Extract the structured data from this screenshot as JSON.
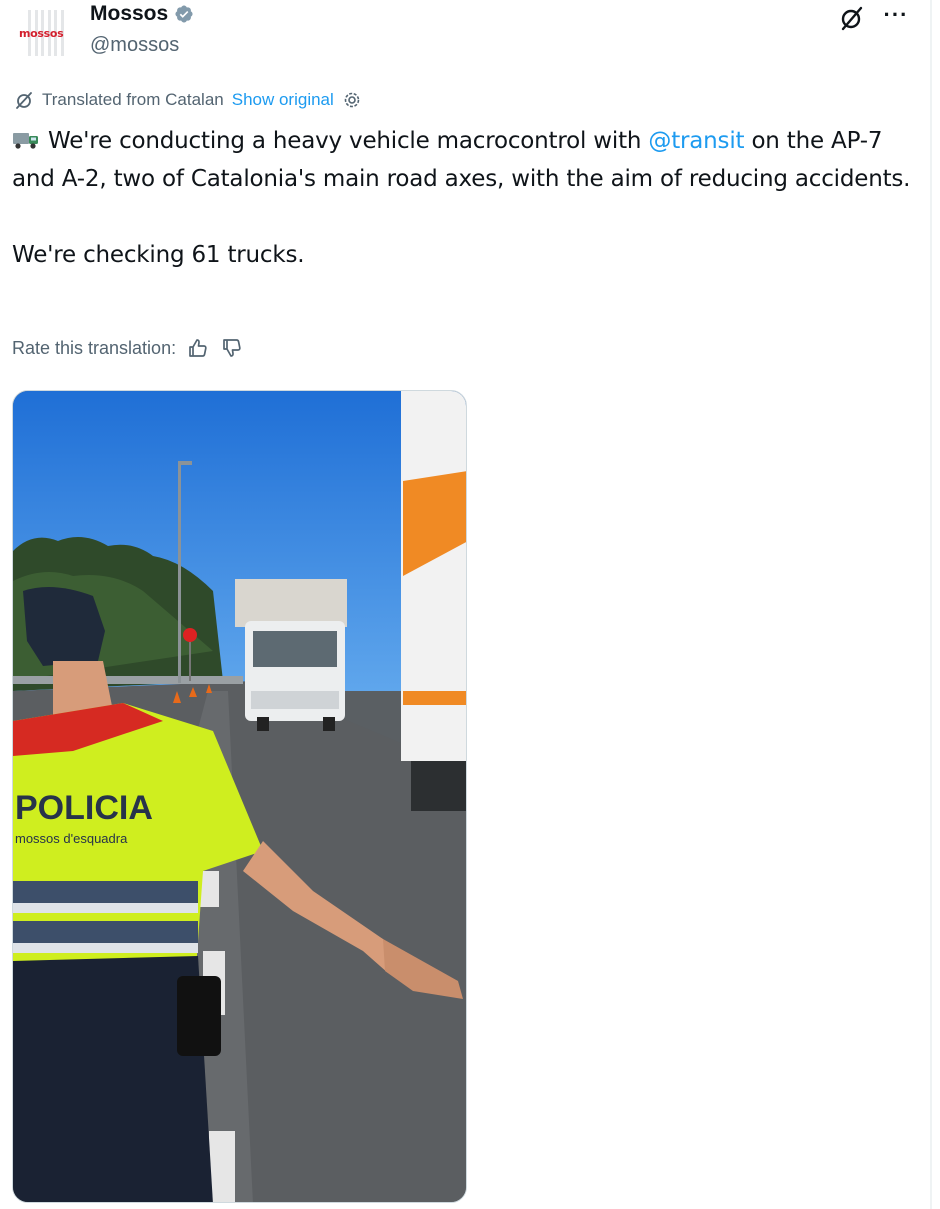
{
  "author": {
    "name": "Mossos",
    "handle": "@mossos",
    "avatar_text": "mossos",
    "verified": true,
    "verified_icon": "verified-badge-icon"
  },
  "header_actions": {
    "grok_icon": "grok-icon",
    "more_icon": "more-options-icon",
    "more_label": "···"
  },
  "translation": {
    "label": "Translated from Catalan",
    "show_original": "Show original",
    "settings_icon": "gear-icon",
    "rate_label": "Rate this translation:",
    "thumbs_up_icon": "thumbs-up-icon",
    "thumbs_down_icon": "thumbs-down-icon"
  },
  "tweet": {
    "emoji": "truck-emoji",
    "text_before_mention": "We're conducting a heavy vehicle macrocontrol with ",
    "mention": "@transit",
    "text_after_mention": " on the AP-7 and A-2, two of Catalonia's main road axes, with the aim of reducing accidents.",
    "second_paragraph": "We're checking 61 trucks."
  },
  "media": {
    "vest_text": "POLICIA",
    "vest_subtext": "mossos d'esquadra",
    "description_icon": "police-photo"
  },
  "colors": {
    "accent": "#1d9bf0",
    "text": "#0f1419",
    "muted": "#536471",
    "brand": "#d3202e"
  }
}
